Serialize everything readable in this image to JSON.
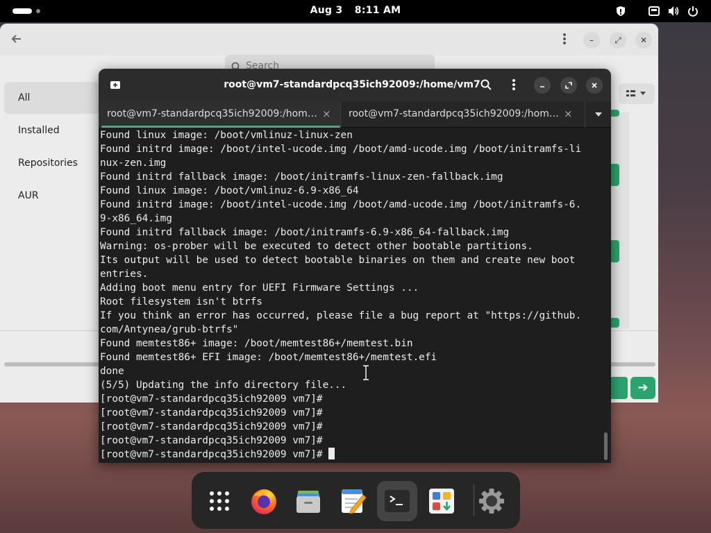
{
  "topbar": {
    "date": "Aug 3",
    "time": "8:11 AM"
  },
  "background_window": {
    "search_placeholder": "Search",
    "sidebar": [
      {
        "label": "All",
        "active": true
      },
      {
        "label": "Installed"
      },
      {
        "label": "Repositories"
      },
      {
        "label": "AUR"
      }
    ]
  },
  "terminal": {
    "title": "root@vm7-standardpcq35ich92009:/home/vm7",
    "tabs": [
      {
        "label": "root@vm7-standardpcq35ich92009:/hom…",
        "active": true
      },
      {
        "label": "root@vm7-standardpcq35ich92009:/hom…",
        "active": false
      }
    ],
    "lines": [
      "Found linux image: /boot/vmlinuz-linux-zen",
      "Found initrd image: /boot/intel-ucode.img /boot/amd-ucode.img /boot/initramfs-li",
      "nux-zen.img",
      "Found initrd fallback image: /boot/initramfs-linux-zen-fallback.img",
      "Found linux image: /boot/vmlinuz-6.9-x86_64",
      "Found initrd image: /boot/intel-ucode.img /boot/amd-ucode.img /boot/initramfs-6.",
      "9-x86_64.img",
      "Found initrd fallback image: /boot/initramfs-6.9-x86_64-fallback.img",
      "Warning: os-prober will be executed to detect other bootable partitions.",
      "Its output will be used to detect bootable binaries on them and create new boot",
      "entries.",
      "Adding boot menu entry for UEFI Firmware Settings ...",
      "Root filesystem isn't btrfs",
      "If you think an error has occurred, please file a bug report at \"https://github.",
      "com/Antynea/grub-btrfs\"",
      "Found memtest86+ image: /boot/memtest86+/memtest.bin",
      "Found memtest86+ EFI image: /boot/memtest86+/memtest.efi",
      "done",
      "(5/5) Updating the info directory file...",
      "[root@vm7-standardpcq35ich92009 vm7]#",
      "[root@vm7-standardpcq35ich92009 vm7]#",
      "[root@vm7-standardpcq35ich92009 vm7]#",
      "[root@vm7-standardpcq35ich92009 vm7]#",
      "[root@vm7-standardpcq35ich92009 vm7]# "
    ]
  },
  "dock": {
    "items": [
      "app-grid-icon",
      "firefox-icon",
      "files-icon",
      "text-editor-icon",
      "terminal-icon",
      "software-icon",
      "settings-icon"
    ],
    "active": "terminal-icon"
  },
  "colors": {
    "accent_green": "#3bb37a",
    "terminal_bg": "#1e1e1e"
  }
}
